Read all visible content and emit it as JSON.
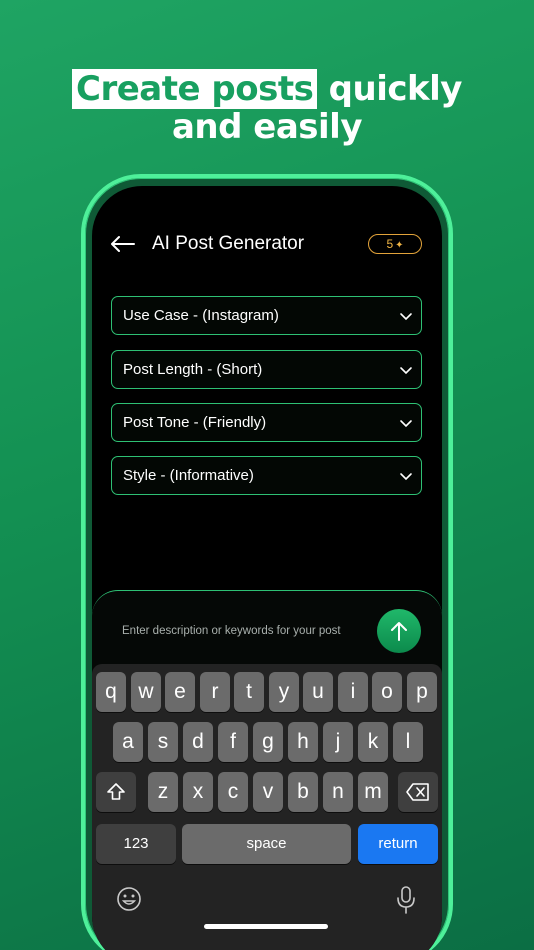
{
  "headline": {
    "highlight": "Create posts",
    "rest_line1": " quickly",
    "line2": "and easily"
  },
  "header": {
    "title": "AI Post Generator",
    "credits": "5",
    "back_icon": "arrow-left-icon",
    "credits_icon": "sparkle-icon"
  },
  "form": {
    "use_case": "Use Case - (Instagram)",
    "post_length": "Post Length - (Short)",
    "post_tone": "Post Tone - (Friendly)",
    "style": "Style - (Informative)"
  },
  "composer": {
    "placeholder": "Enter description or keywords for your post",
    "send_icon": "arrow-up-icon"
  },
  "keyboard": {
    "row1": [
      "q",
      "w",
      "e",
      "r",
      "t",
      "y",
      "u",
      "i",
      "o",
      "p"
    ],
    "row2": [
      "a",
      "s",
      "d",
      "f",
      "g",
      "h",
      "j",
      "k",
      "l"
    ],
    "row3": [
      "z",
      "x",
      "c",
      "v",
      "b",
      "n",
      "m"
    ],
    "numbers": "123",
    "space": "space",
    "return": "return",
    "shift_icon": "shift-icon",
    "delete_icon": "backspace-icon",
    "emoji_icon": "emoji-icon",
    "mic_icon": "microphone-icon"
  },
  "colors": {
    "accent": "#2ec074",
    "credits": "#f0b545",
    "return_key": "#1a78f2",
    "background": "#139052"
  }
}
